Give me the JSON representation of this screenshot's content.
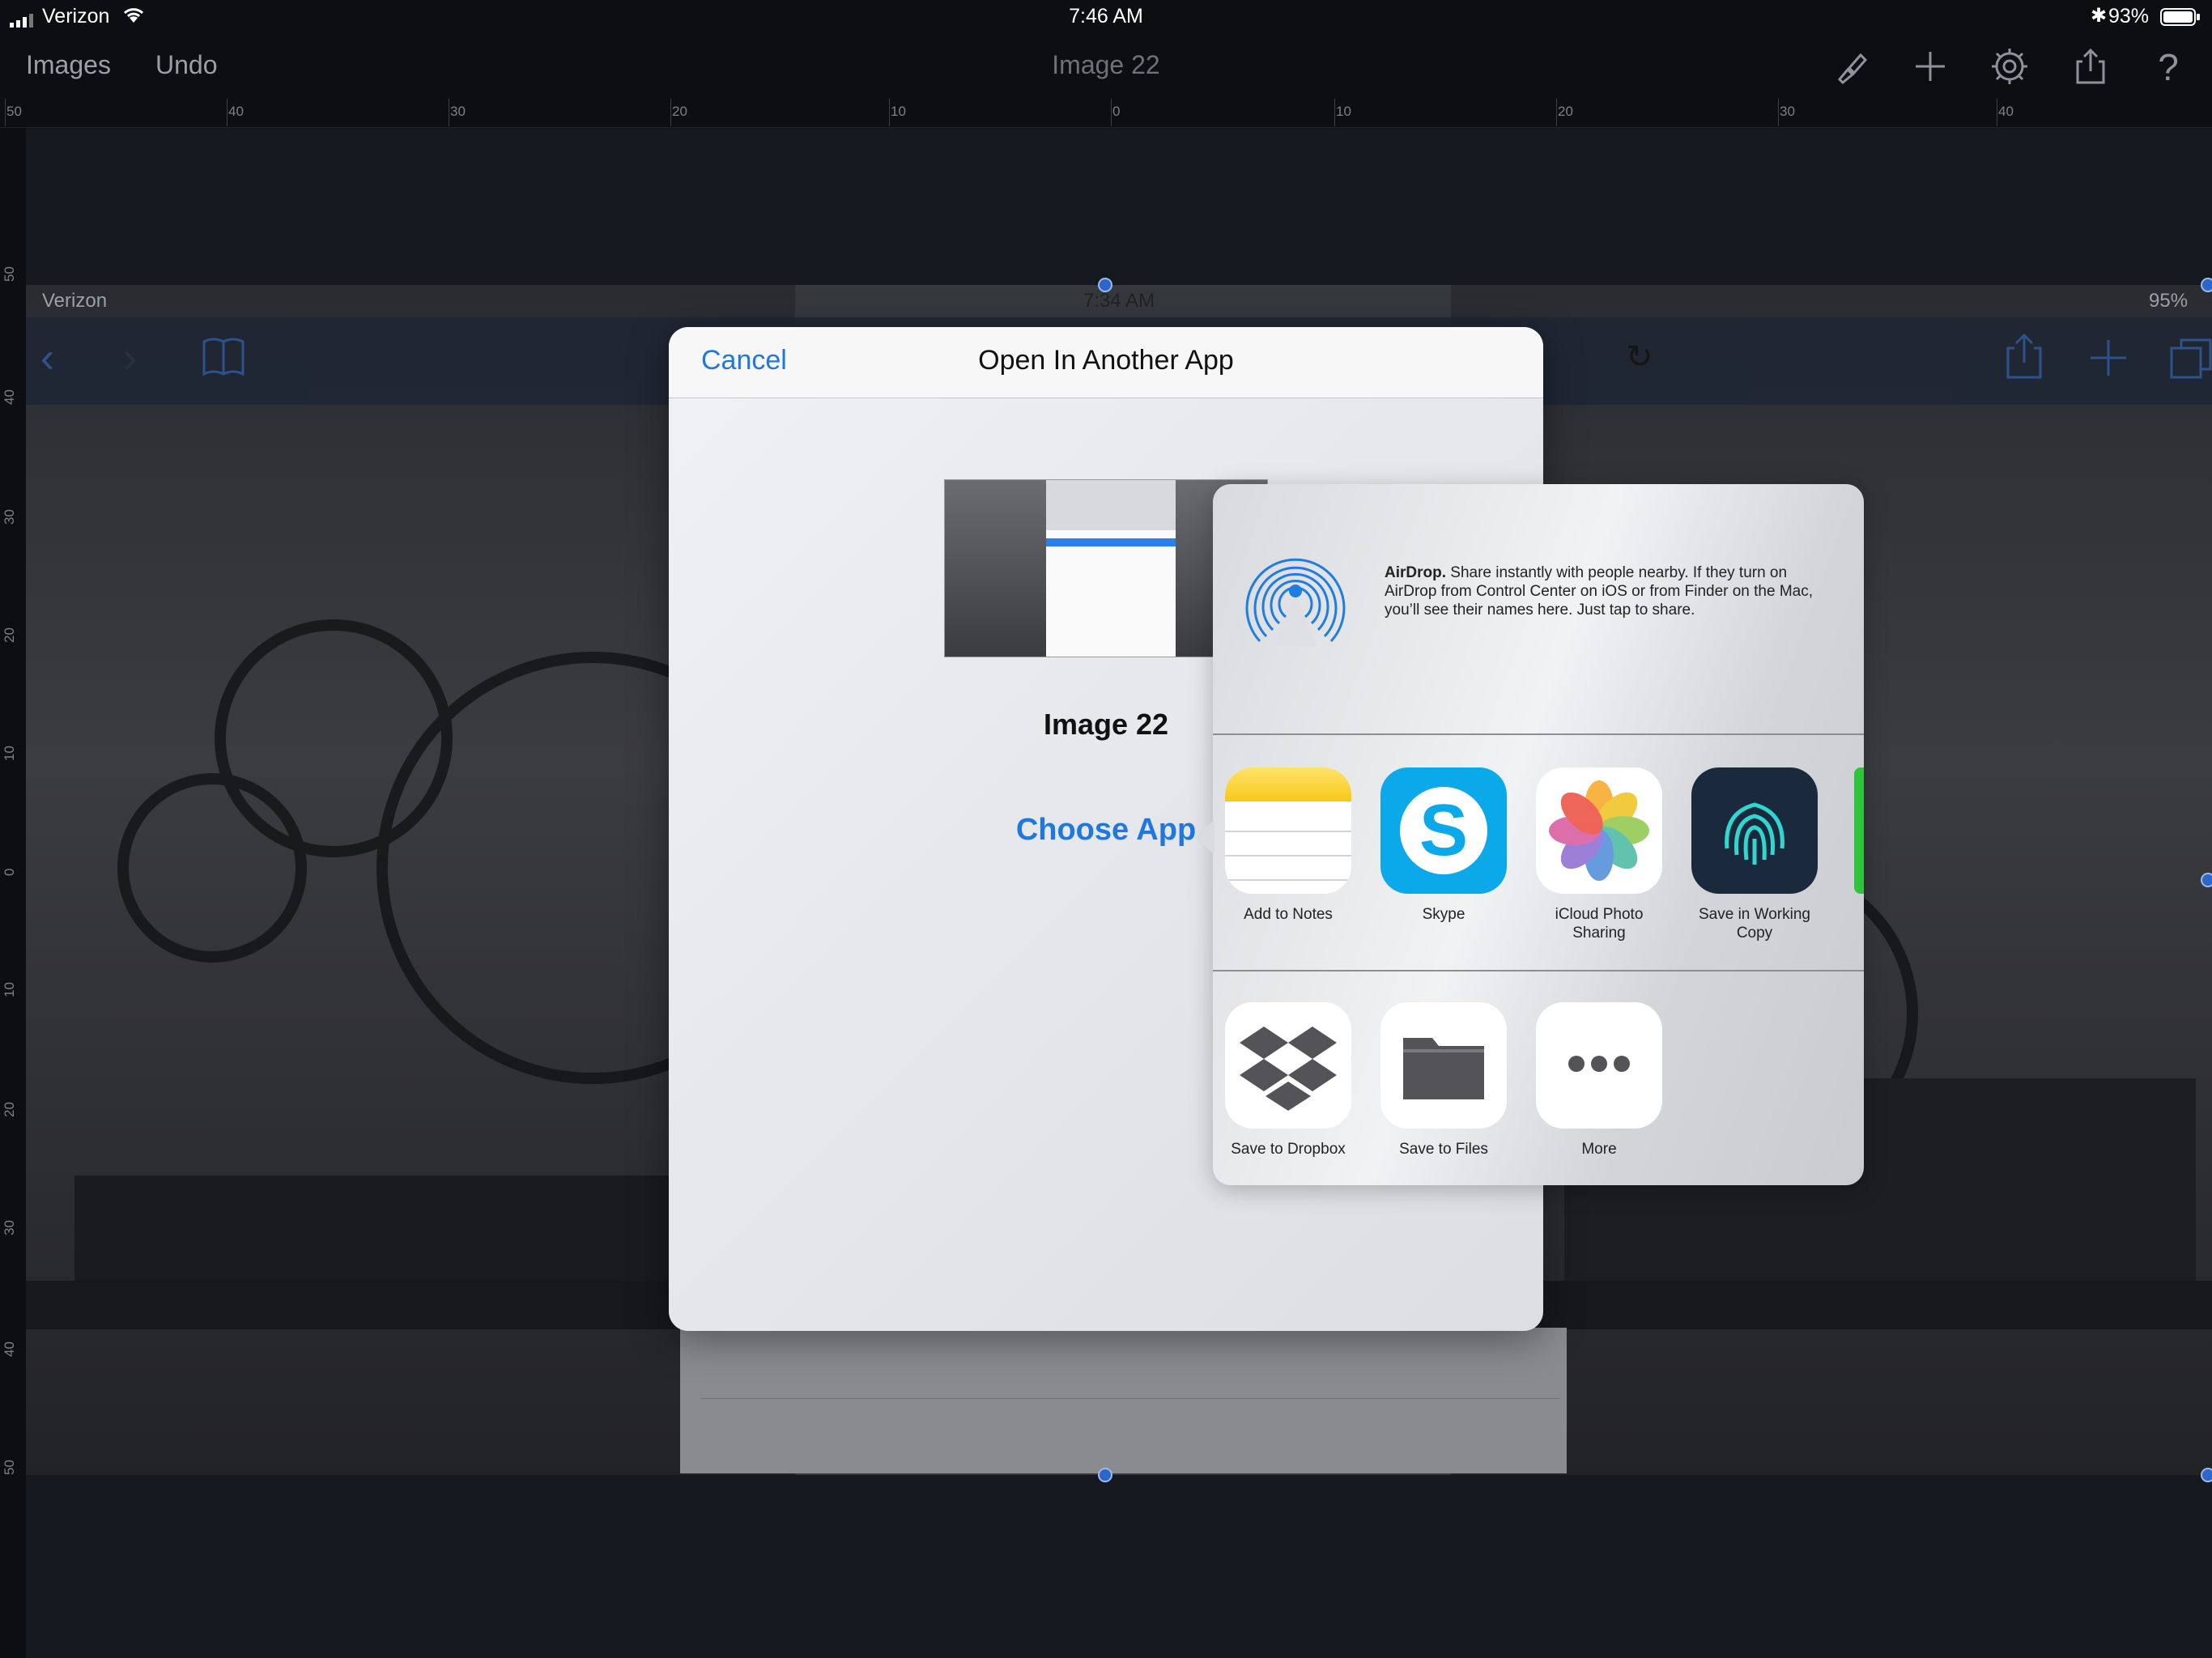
{
  "status": {
    "carrier": "Verizon",
    "time": "7:46 AM",
    "battery": "93%"
  },
  "toolbar": {
    "images_label": "Images",
    "undo_label": "Undo",
    "title": "Image 22"
  },
  "ruler": {
    "h_ticks": [
      "50",
      "40",
      "30",
      "20",
      "10",
      "0",
      "10",
      "20",
      "30",
      "40"
    ],
    "v_ticks": [
      "50",
      "40",
      "30",
      "20",
      "10",
      "0",
      "10",
      "20",
      "30",
      "40",
      "50"
    ]
  },
  "inner_screenshot": {
    "carrier": "Verizon",
    "time": "7:34 AM",
    "battery": "95%"
  },
  "dialog": {
    "cancel_label": "Cancel",
    "title": "Open In Another App",
    "image_name": "Image 22",
    "choose_label": "Choose App"
  },
  "share": {
    "airdrop_bold": "AirDrop.",
    "airdrop_text": " Share instantly with people nearby. If they turn on AirDrop from Control Center on iOS or from Finder on the Mac, you’ll see their names here. Just tap to share.",
    "apps": [
      {
        "label": "Add to Notes",
        "icon": "notes-icon"
      },
      {
        "label": "Skype",
        "icon": "skype-icon"
      },
      {
        "label": "iCloud Photo Sharing",
        "icon": "photos-icon"
      },
      {
        "label": "Save in Working Copy",
        "icon": "working-copy-icon"
      }
    ],
    "actions": [
      {
        "label": "Save to Dropbox",
        "icon": "dropbox-icon"
      },
      {
        "label": "Save to Files",
        "icon": "folder-icon"
      },
      {
        "label": "More",
        "icon": "more-icon"
      }
    ]
  }
}
